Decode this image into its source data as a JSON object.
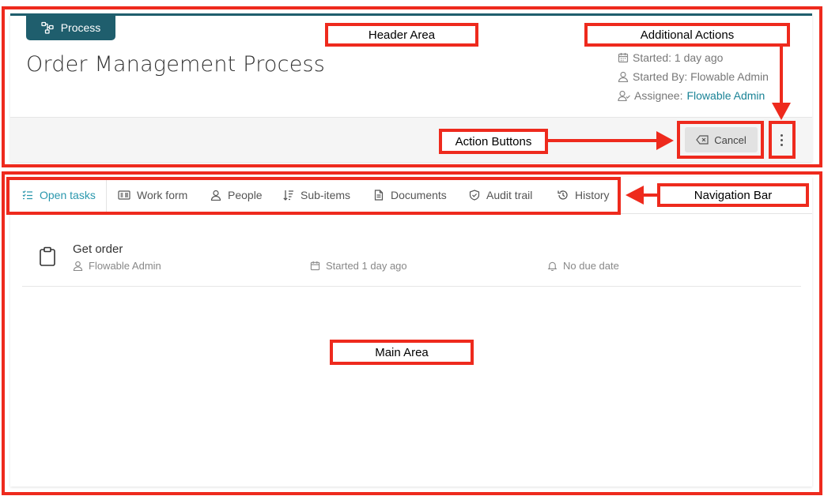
{
  "header": {
    "badge_label": "Process",
    "title": "Order Management Process",
    "started": "Started: 1 day ago",
    "started_by": "Started By: Flowable Admin",
    "assignee_label": "Assignee:",
    "assignee_value": "Flowable Admin",
    "cancel_label": "Cancel"
  },
  "tabs": [
    {
      "label": "Open tasks",
      "icon": "checklist-icon",
      "active": true
    },
    {
      "label": "Work form",
      "icon": "form-icon"
    },
    {
      "label": "People",
      "icon": "person-icon"
    },
    {
      "label": "Sub-items",
      "icon": "sort-icon"
    },
    {
      "label": "Documents",
      "icon": "document-icon"
    },
    {
      "label": "Audit trail",
      "icon": "shield-check-icon"
    },
    {
      "label": "History",
      "icon": "history-icon"
    }
  ],
  "tasks": [
    {
      "title": "Get order",
      "assignee": "Flowable Admin",
      "started": "Started 1 day ago",
      "due": "No due date"
    }
  ],
  "annotations": {
    "header_area": "Header Area",
    "additional_actions": "Additional Actions",
    "action_buttons": "Action Buttons",
    "navigation_bar": "Navigation Bar",
    "main_area": "Main Area"
  },
  "colors": {
    "brand": "#1f5e6d",
    "active_tab": "#2a97ad",
    "link": "#1a8396",
    "annotation": "#ee2a1d"
  }
}
